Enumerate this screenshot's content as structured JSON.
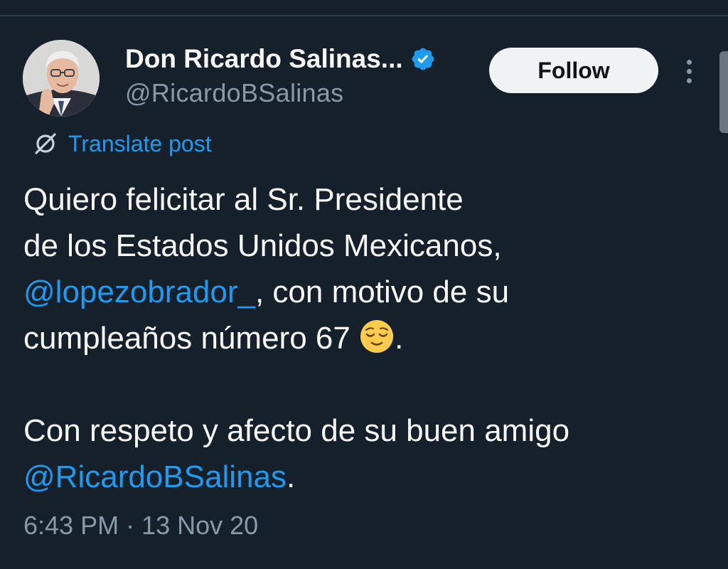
{
  "author": {
    "display_name": "Don Ricardo Salinas...",
    "handle": "@RicardoBSalinas",
    "verified": true
  },
  "actions": {
    "follow_label": "Follow",
    "more_icon": "more-vertical-icon"
  },
  "translate": {
    "label": "Translate post",
    "icon": "translate-icon"
  },
  "tweet": {
    "line1": "Quiero felicitar al Sr. Presidente",
    "line2": "de los Estados Unidos Mexicanos,",
    "line3_mention": "@lopezobrador_",
    "line3_rest": ", con motivo de su",
    "line4_text": "cumpleaños número 67 ",
    "line4_emoji": "relieved-face",
    "line4_end": ".",
    "line5": "Con respeto y afecto de su buen amigo",
    "line6_mention": "@RicardoBSalinas",
    "line6_end": "."
  },
  "meta": {
    "timestamp": "6:43 PM · 13 Nov 20"
  },
  "colors": {
    "background": "#15202b",
    "accent": "#1d9bf0",
    "secondary_text": "#8b98a5",
    "primary_text": "#f7f9f9"
  }
}
